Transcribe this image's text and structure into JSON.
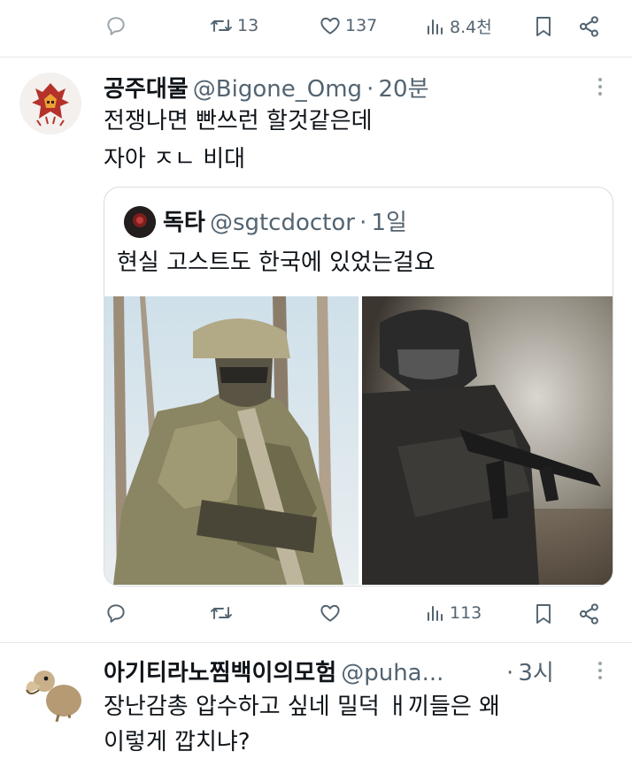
{
  "top_actions": {
    "retweets": "13",
    "likes": "137",
    "views": "8.4천"
  },
  "tweet": {
    "name": "공주대물",
    "handle": "@Bigone_Omg",
    "sep": "·",
    "time": "20분",
    "line1": "전쟁나면 빤쓰런 할것같은데",
    "line2": "자아 ㅈㄴ 비대"
  },
  "quote": {
    "name": "독타",
    "handle": "@sgtcdoctor",
    "sep": "·",
    "time": "1일",
    "text": "현실 고스트도 한국에 있었는걸요"
  },
  "tweet_actions": {
    "views": "113"
  },
  "reply": {
    "name": "아기티라노찜백이의모험",
    "handle": "@puha...",
    "sep": "·",
    "time": "3시",
    "line1": "장난감총 압수하고 싶네 밀덕 ㅐ끼들은 왜",
    "line2": "이렇게 깝치냐?"
  },
  "colors": {
    "text": "#0f1419",
    "muted": "#536471",
    "border": "#e6e9ea"
  }
}
